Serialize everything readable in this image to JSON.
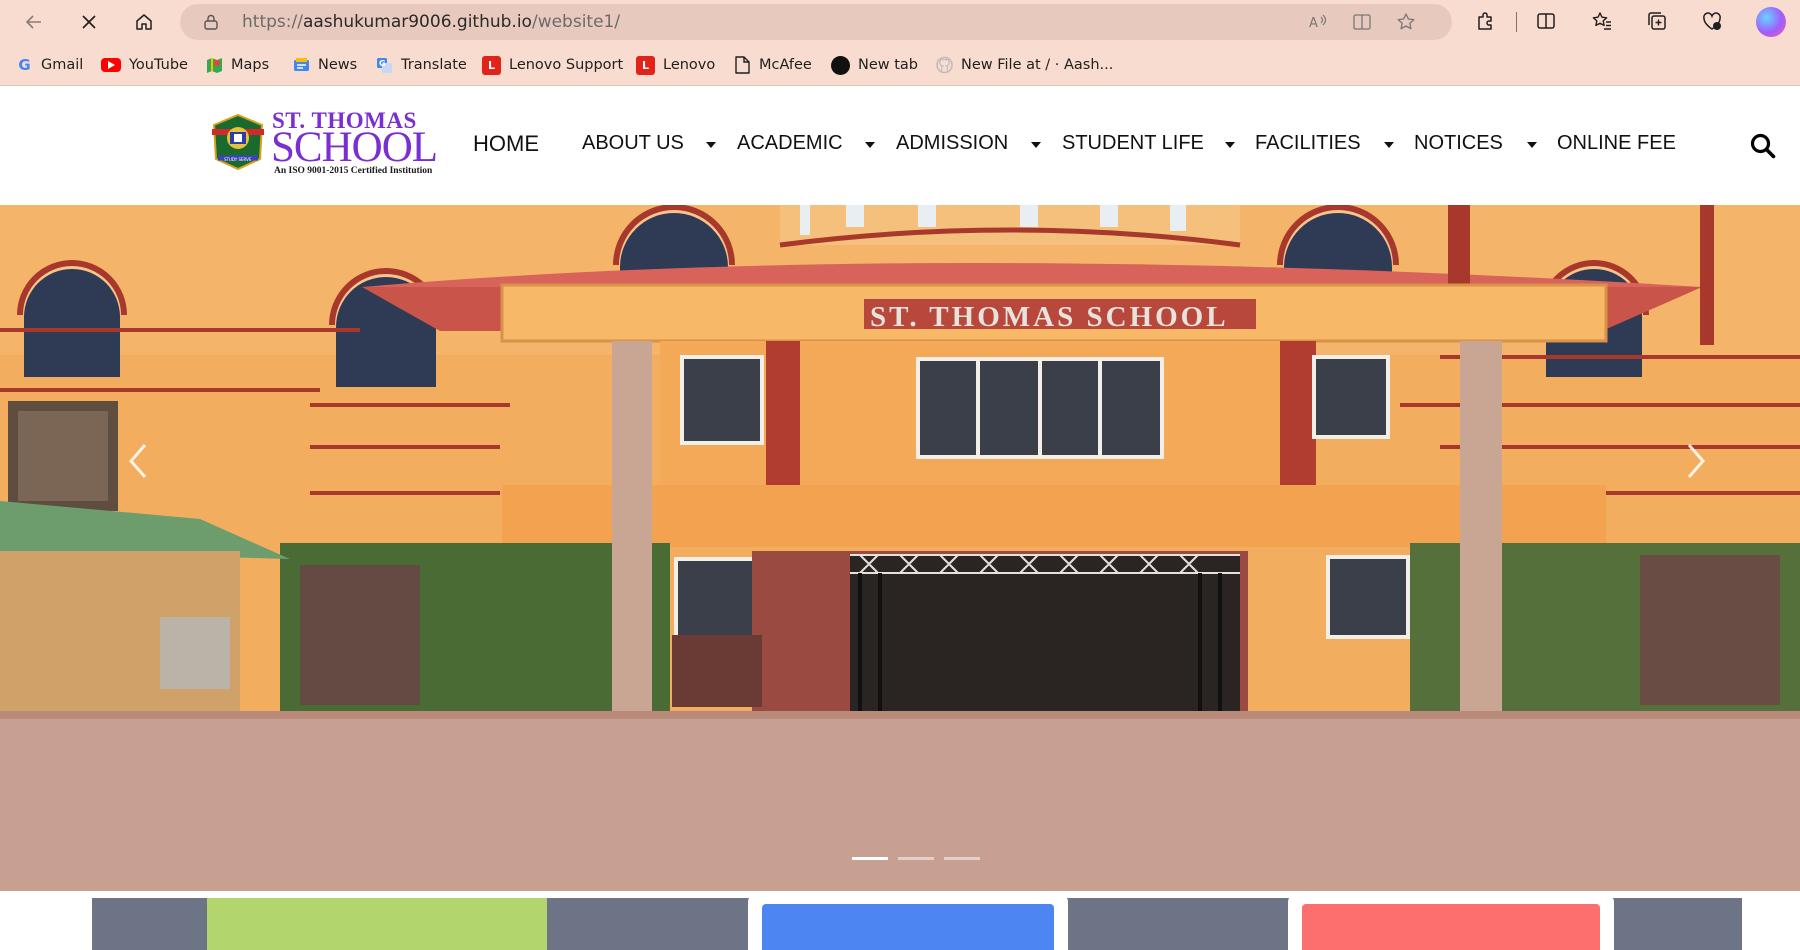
{
  "browser": {
    "url_prefix": "https://",
    "url_host": "aashukumar9006.github.io",
    "url_path": "/website1/",
    "icons": [
      "back-icon",
      "stop-icon",
      "home-icon",
      "lock-icon",
      "read-aloud-icon",
      "immersive-reader-icon",
      "favorite-star-icon",
      "extensions-icon",
      "split-screen-icon",
      "favorites-icon",
      "collections-icon",
      "browser-essentials-icon",
      "profile-avatar"
    ]
  },
  "bookmarks": [
    {
      "label": "Gmail",
      "icon": "google-icon"
    },
    {
      "label": "YouTube",
      "icon": "youtube-icon"
    },
    {
      "label": "Maps",
      "icon": "maps-icon"
    },
    {
      "label": "News",
      "icon": "news-icon"
    },
    {
      "label": "Translate",
      "icon": "translate-icon"
    },
    {
      "label": "Lenovo Support",
      "icon": "lenovo-icon"
    },
    {
      "label": "Lenovo",
      "icon": "lenovo-icon"
    },
    {
      "label": "McAfee",
      "icon": "page-icon"
    },
    {
      "label": "New tab",
      "icon": "circle-icon"
    },
    {
      "label": "New File at / · Aash...",
      "icon": "github-icon"
    }
  ],
  "site": {
    "logo": {
      "line1": "ST. THOMAS",
      "line2": "SCHOOL",
      "line3": "An ISO 9001-2015 Certified Institution"
    },
    "nav": [
      {
        "label": "HOME",
        "dropdown": false
      },
      {
        "label": "ABOUT US",
        "dropdown": true
      },
      {
        "label": "ACADEMIC",
        "dropdown": true
      },
      {
        "label": "ADMISSION",
        "dropdown": true
      },
      {
        "label": "STUDENT LIFE",
        "dropdown": true
      },
      {
        "label": "FACILITIES",
        "dropdown": true
      },
      {
        "label": "NOTICES",
        "dropdown": true
      },
      {
        "label": "ONLINE FEE",
        "dropdown": false
      }
    ],
    "hero": {
      "building_sign": "ST. THOMAS SCHOOL",
      "slide_count": 3,
      "active_slide": 1
    }
  },
  "colors": {
    "chrome_bg": "#f9dcd0",
    "logo_purple": "#7a2fd0",
    "card_green": "#b3d56d",
    "card_blue": "#4d85f3",
    "card_red": "#fd6e6e",
    "strip_gray": "#6d7486"
  }
}
